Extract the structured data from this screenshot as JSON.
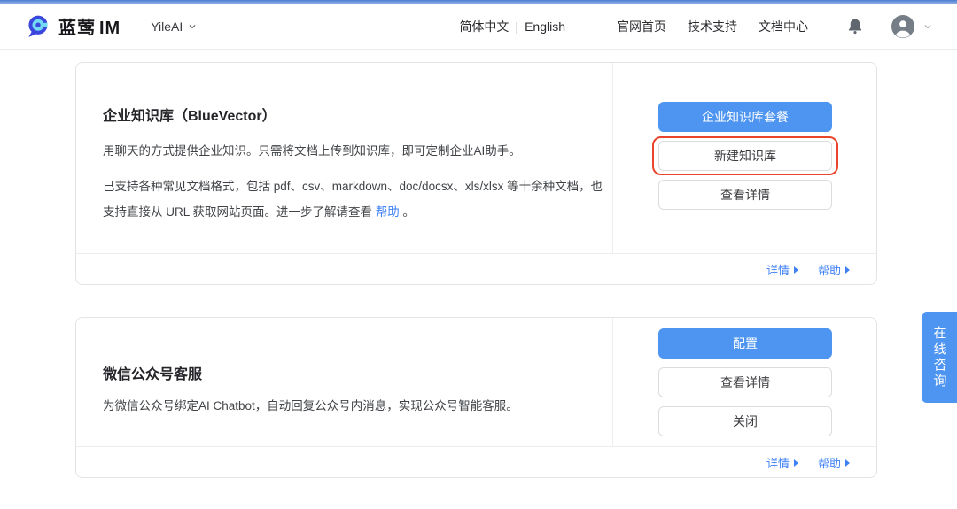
{
  "header": {
    "brand_cn": "蓝莺",
    "brand_en": "IM",
    "workspace": "YileAI",
    "lang_zh": "简体中文",
    "lang_divider": "|",
    "lang_en": "English",
    "nav_home": "官网首页",
    "nav_support": "技术支持",
    "nav_docs": "文档中心"
  },
  "card1": {
    "title": "企业知识库（BlueVector）",
    "p1": "用聊天的方式提供企业知识。只需将文档上传到知识库，即可定制企业AI助手。",
    "p2_before": "已支持各种常见文档格式，包括 pdf、csv、markdown、doc/docsx、xls/xlsx 等十余种文档，也支持直接从 URL 获取网站页面。进一步了解请查看 ",
    "p2_link": "帮助",
    "p2_after": " 。",
    "btn_primary": "企业知识库套餐",
    "btn_new": "新建知识库",
    "btn_detail": "查看详情",
    "footer_detail": "详情",
    "footer_help": "帮助"
  },
  "card2": {
    "title": "微信公众号客服",
    "p1": "为微信公众号绑定AI Chatbot，自动回复公众号内消息，实现公众号智能客服。",
    "btn_primary": "配置",
    "btn_detail": "查看详情",
    "btn_close": "关闭",
    "footer_detail": "详情",
    "footer_help": "帮助"
  },
  "floating_tab": {
    "label": "在线咨询"
  },
  "colors": {
    "primary_blue": "#4e94f1",
    "link_blue": "#3e80f6",
    "highlight_red": "#e8452c",
    "accent_cyan": "#7ee0f4"
  }
}
